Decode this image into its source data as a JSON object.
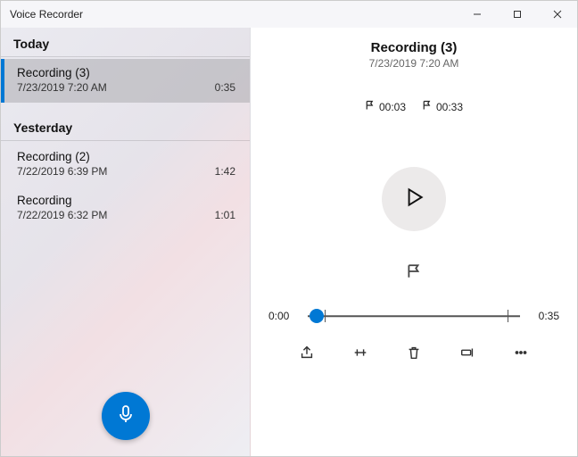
{
  "window": {
    "title": "Voice Recorder"
  },
  "sidebar": {
    "groups": [
      {
        "label": "Today",
        "items": [
          {
            "title": "Recording (3)",
            "subtitle": "7/23/2019 7:20 AM",
            "duration": "0:35",
            "selected": true
          }
        ]
      },
      {
        "label": "Yesterday",
        "items": [
          {
            "title": "Recording (2)",
            "subtitle": "7/22/2019 6:39 PM",
            "duration": "1:42",
            "selected": false
          },
          {
            "title": "Recording",
            "subtitle": "7/22/2019 6:32 PM",
            "duration": "1:01",
            "selected": false
          }
        ]
      }
    ]
  },
  "detail": {
    "title": "Recording (3)",
    "subtitle": "7/23/2019 7:20 AM",
    "markers": [
      {
        "time": "00:03"
      },
      {
        "time": "00:33"
      }
    ],
    "timeline": {
      "current": "0:00",
      "total": "0:35",
      "position_pct": 4,
      "ticks_pct": [
        8,
        94
      ]
    }
  }
}
